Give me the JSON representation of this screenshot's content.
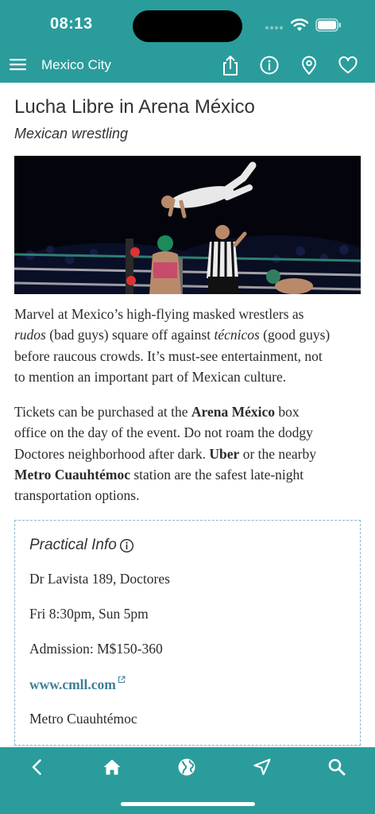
{
  "status_bar": {
    "time": "08:13",
    "icons": [
      "cellular-signal-icon",
      "wifi-icon",
      "battery-icon"
    ]
  },
  "navbar": {
    "title": "Mexico City",
    "icons": [
      "menu-icon",
      "share-icon",
      "info-icon",
      "map-pin-icon",
      "heart-icon"
    ]
  },
  "article": {
    "title": "Lucha Libre in Arena México",
    "subtitle": "Mexican wrestling",
    "photo_icon": "wrestling-photo",
    "paragraph1": {
      "line1": "Marvel at Mexico’s high-flying masked wrestlers as",
      "rudos": "rudos",
      "l2_mid": " (bad guys) square off against ",
      "tecnicos": "técnicos",
      "l2_end": " (good guys)",
      "line3": "before raucous crowds. It’s must-see entertainment, not",
      "line4": "to mention an important part of Mexican culture."
    },
    "paragraph2": {
      "line1_start": "Tickets can be purchased at the ",
      "arena": "Arena México",
      "line1_end": " box",
      "line2": "office on the day of the event. Do not roam the dodgy",
      "line3_start": "Doctores neighborhood after dark. ",
      "uber": "Uber",
      "line3_end": " or the nearby",
      "metro": "Metro Cuauhtémoc",
      "line4_end": " station are the safest late-night",
      "line5": "transportation options."
    }
  },
  "practical_info": {
    "title": "Practical Info",
    "address": "Dr Lavista 189, Doctores",
    "hours": "Fri 8:30pm, Sun 5pm",
    "admission": "Admission: M$150-360",
    "website": "www.cmll.com",
    "transit": "Metro Cuauhtémoc"
  },
  "tabbar": {
    "icons": [
      "back-icon",
      "home-icon",
      "globe-icon",
      "navigation-arrow-icon",
      "search-icon"
    ]
  },
  "colors": {
    "brand": "#2a9c9c",
    "link": "#3d7f99",
    "border": "#86b7cc"
  }
}
